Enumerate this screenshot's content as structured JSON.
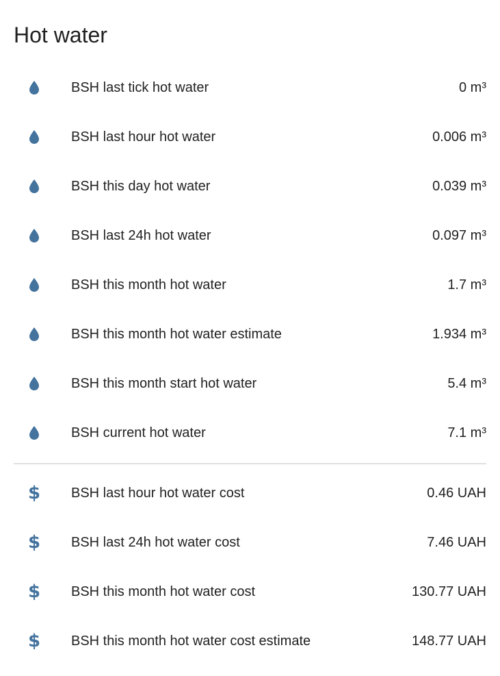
{
  "card": {
    "title": "Hot water"
  },
  "colors": {
    "icon": "#44739e",
    "divider": "#e0e0e0",
    "text": "#212121"
  },
  "volume_rows": [
    {
      "icon": "water-drop-icon",
      "name": "BSH last tick hot water",
      "state": "0 m³"
    },
    {
      "icon": "water-drop-icon",
      "name": "BSH last hour hot water",
      "state": "0.006 m³"
    },
    {
      "icon": "water-drop-icon",
      "name": "BSH this day hot water",
      "state": "0.039 m³"
    },
    {
      "icon": "water-drop-icon",
      "name": "BSH last 24h hot water",
      "state": "0.097 m³"
    },
    {
      "icon": "water-drop-icon",
      "name": "BSH this month hot water",
      "state": "1.7 m³"
    },
    {
      "icon": "water-drop-icon",
      "name": "BSH this month hot water estimate",
      "state": "1.934 m³"
    },
    {
      "icon": "water-drop-icon",
      "name": "BSH this month start hot water",
      "state": "5.4 m³"
    },
    {
      "icon": "water-drop-icon",
      "name": "BSH current hot water",
      "state": "7.1 m³"
    }
  ],
  "cost_rows": [
    {
      "icon": "dollar-icon",
      "name": "BSH last hour hot water cost",
      "state": "0.46 UAH"
    },
    {
      "icon": "dollar-icon",
      "name": "BSH last 24h hot water cost",
      "state": "7.46 UAH"
    },
    {
      "icon": "dollar-icon",
      "name": "BSH this month hot water cost",
      "state": "130.77 UAH"
    },
    {
      "icon": "dollar-icon",
      "name": "BSH this month hot water cost estimate",
      "state": "148.77 UAH"
    }
  ],
  "icons": {
    "dollar_glyph": "$"
  }
}
